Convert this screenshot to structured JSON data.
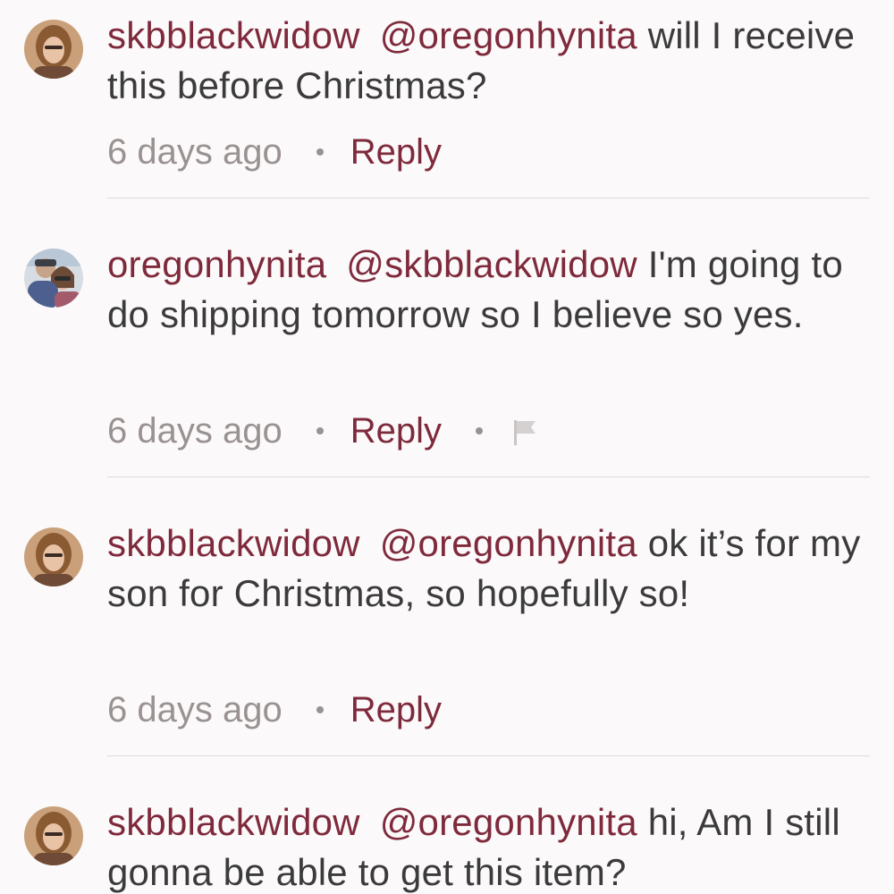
{
  "comments": [
    {
      "username": "skbblackwidow",
      "mention": "@oregonhynita",
      "text": "will I receive this before Christmas?",
      "time": "6 days ago",
      "reply_label": "Reply"
    },
    {
      "username": "oregonhynita",
      "mention": "@skbblackwidow",
      "text": "I'm going to do shipping tomorrow so I believe so yes.",
      "time": "6 days ago",
      "reply_label": "Reply",
      "flag_icon": "flag-icon"
    },
    {
      "username": "skbblackwidow",
      "mention": "@oregonhynita",
      "text": "ok it’s for my son for Christmas, so hopefully so!",
      "time": "6 days ago",
      "reply_label": "Reply"
    },
    {
      "username": "skbblackwidow",
      "mention": "@oregonhynita",
      "text": "hi, Am I still gonna be able to get this item?"
    }
  ],
  "colors": {
    "accent": "#7f2a3c",
    "body_text": "#3b3b3b",
    "muted": "#9a9292",
    "background": "#fbf9f9"
  }
}
